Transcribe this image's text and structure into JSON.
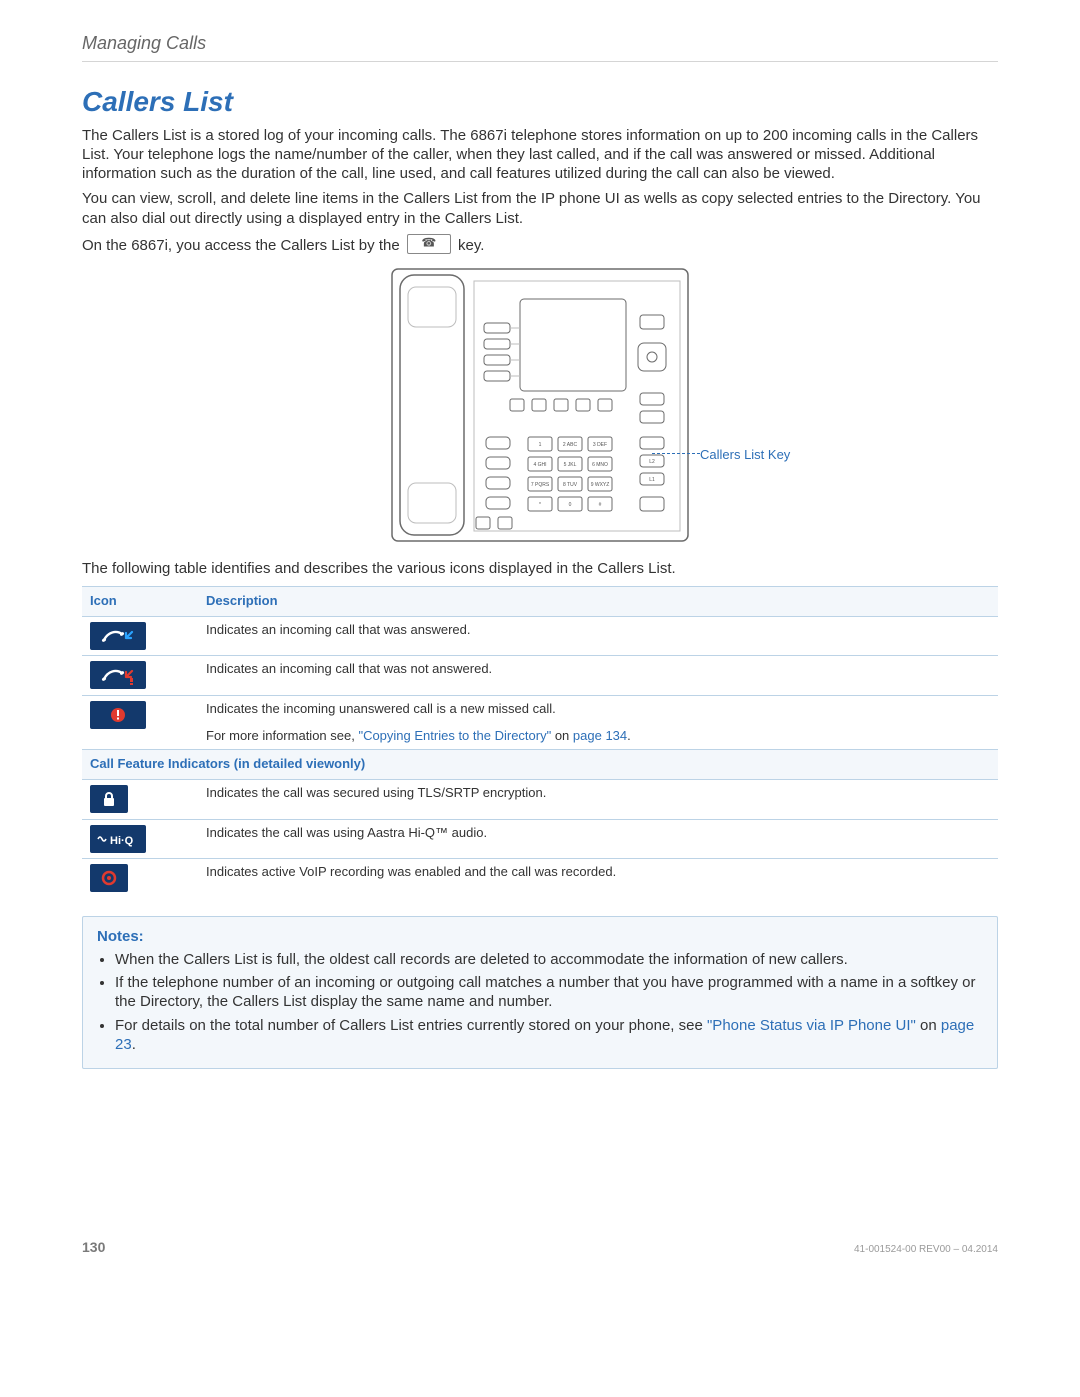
{
  "header": {
    "running": "Managing Calls"
  },
  "title": "Callers List",
  "paragraphs": {
    "p1": "The Callers List is a stored log of your incoming calls. The 6867i telephone stores information on up to 200 incoming calls in the Callers List. Your telephone logs the name/number of the caller, when they last called, and if the call was answered or missed. Additional information such as the duration of the call, line used, and call features utilized during the call can also be viewed.",
    "p2": "You can view, scroll, and delete line items in the Callers List from the IP phone UI as wells as copy selected entries to the Directory. You can also dial out directly using a displayed entry in the Callers List.",
    "p3a": "On the 6867i, you access the Callers List by the",
    "p3b": "key.",
    "callout": "Callers List Key",
    "p4": "The following table identifies and describes the various icons displayed in the Callers List."
  },
  "table": {
    "headers": {
      "icon": "Icon",
      "desc": "Description"
    },
    "rows": [
      {
        "icon": "handset-in-answered",
        "desc": "Indicates an incoming call that was answered."
      },
      {
        "icon": "handset-in-missed",
        "desc": "Indicates an incoming call that was not answered."
      },
      {
        "icon": "new-missed",
        "desc_a": "Indicates the incoming unanswered call is a new missed call.",
        "desc_b_pre": "For more information see, ",
        "desc_b_link": "\"Copying Entries to the Directory\"",
        "desc_b_mid": " on ",
        "desc_b_page": "page 134",
        "desc_b_post": "."
      }
    ],
    "section_label": "Call Feature Indicators (in detailed viewonly)",
    "feature_rows": [
      {
        "icon": "lock",
        "desc": "Indicates the call was secured using TLS/SRTP encryption."
      },
      {
        "icon": "hiq",
        "desc": "Indicates the call was using Aastra Hi-Q™ audio."
      },
      {
        "icon": "record",
        "desc": "Indicates active VoIP recording was enabled and the call was recorded."
      }
    ]
  },
  "notes": {
    "title": "Notes:",
    "items": [
      {
        "text": "When the Callers List is full, the oldest call records are deleted to accommodate the information of new callers."
      },
      {
        "text": "If the telephone number of an incoming or outgoing call matches a number that you have programmed with a name in a softkey or the Directory, the Callers List display the same name and number."
      },
      {
        "text_pre": "For details on the total number of Callers List entries currently stored on your phone, see ",
        "link": "\"Phone Status via IP Phone UI\"",
        "mid": " on ",
        "page": "page 23",
        "post": "."
      }
    ]
  },
  "footer": {
    "page": "130",
    "rev": "41-001524-00 REV00 – 04.2014"
  }
}
